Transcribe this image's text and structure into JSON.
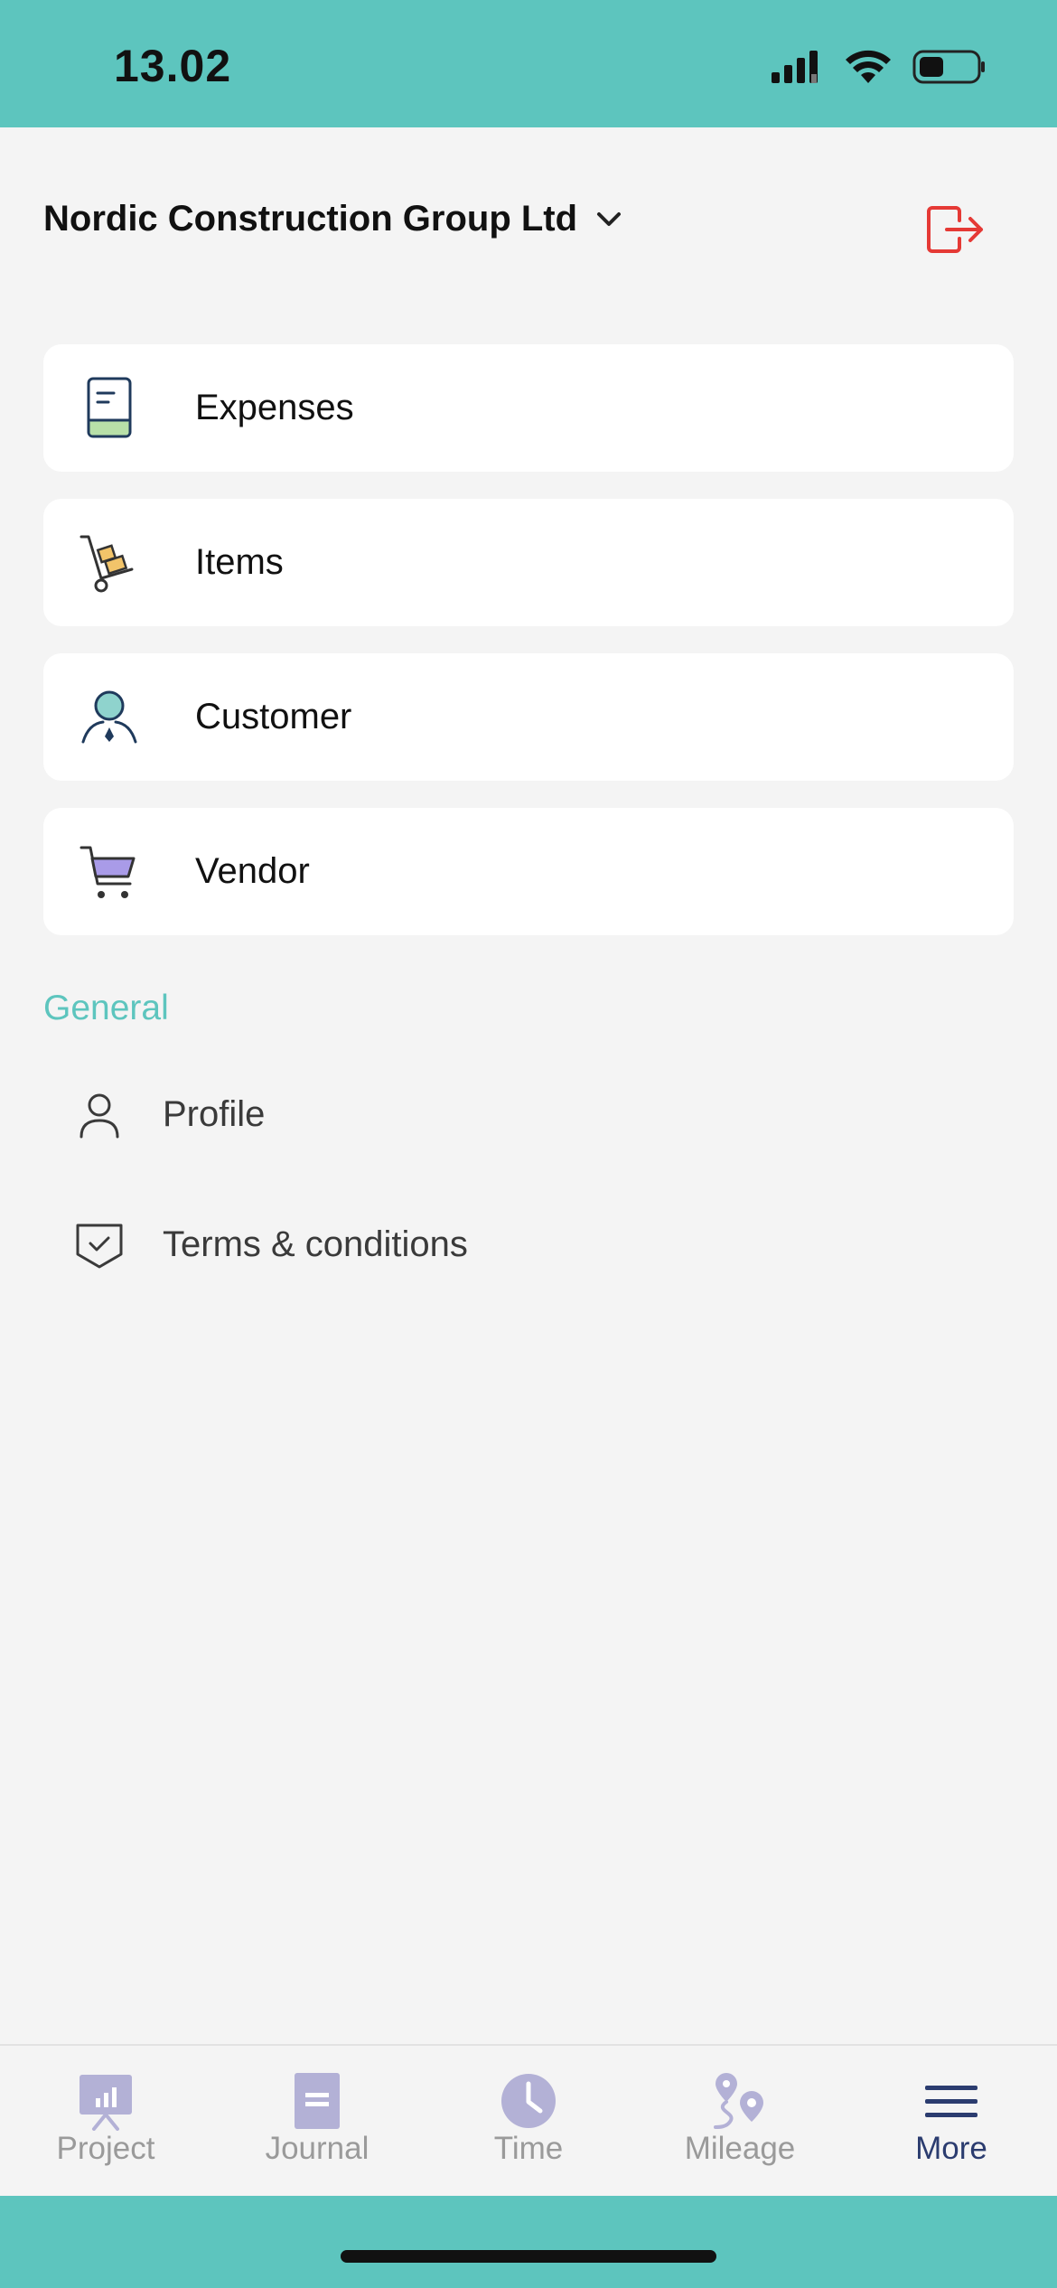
{
  "status": {
    "time": "13.02"
  },
  "header": {
    "company": "Nordic Construction Group Ltd"
  },
  "cards": [
    {
      "label": "Expenses",
      "icon": "receipt-icon"
    },
    {
      "label": "Items",
      "icon": "hand-truck-icon"
    },
    {
      "label": "Customer",
      "icon": "customer-icon"
    },
    {
      "label": "Vendor",
      "icon": "cart-icon"
    }
  ],
  "general": {
    "title": "General",
    "items": [
      {
        "label": "Profile",
        "icon": "person-icon"
      },
      {
        "label": "Terms & conditions",
        "icon": "shield-check-icon"
      }
    ]
  },
  "tabs": [
    {
      "label": "Project",
      "icon": "project-chart-icon"
    },
    {
      "label": "Journal",
      "icon": "journal-icon"
    },
    {
      "label": "Time",
      "icon": "clock-icon"
    },
    {
      "label": "Mileage",
      "icon": "map-pin-icon"
    },
    {
      "label": "More",
      "icon": "menu-icon",
      "active": true
    }
  ],
  "colors": {
    "accent": "#5dc5be",
    "logout": "#e53935",
    "tab_inactive": "#b3b1d6",
    "tab_active": "#2b3c6f"
  }
}
